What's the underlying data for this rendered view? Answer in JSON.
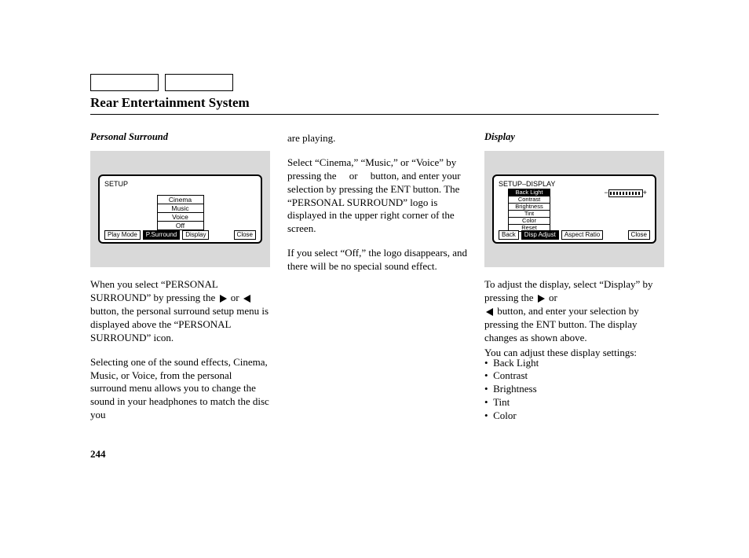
{
  "page_title": "Rear Entertainment System",
  "page_number": "244",
  "col1": {
    "heading": "Personal Surround",
    "screen": {
      "title": "SETUP",
      "menu": [
        "Cinema",
        "Music",
        "Voice",
        "Off"
      ],
      "tabs": {
        "play": "Play Mode",
        "selected": "P.Surround",
        "display": "Display",
        "close": "Close"
      }
    },
    "p1_a": "When you select “PERSONAL SURROUND” by pressing the",
    "p1_b": "or",
    "p1_c": "button, the personal surround setup menu is displayed above the “PERSONAL SURROUND” icon.",
    "p2": "Selecting one of the sound effects, Cinema, Music, or Voice, from the personal surround menu allows you to change the sound in your headphones to match the disc you"
  },
  "col2": {
    "p1": "are playing.",
    "p2": "Select “Cinema,” “Music,” or “Voice” by pressing the     or     button, and enter your selection by pressing the ENT button. The “PERSONAL SURROUND” logo is displayed in the upper right corner of the screen.",
    "p3": "If you select “Off,” the logo disappears, and there will be no special sound effect."
  },
  "col3": {
    "heading": "Display",
    "screen": {
      "title": "SETUP–DISPLAY",
      "list": [
        "Back Light",
        "Contrast",
        "Brightness",
        "Tint",
        "Color",
        "Reset"
      ],
      "tabs": {
        "back": "Back",
        "selected": "Disp Adjust",
        "aspect": "Aspect Ratio",
        "close": "Close"
      },
      "slider": {
        "minus": "−",
        "plus": "+"
      }
    },
    "p1_a": "To adjust the display, select “Display” by pressing the",
    "p1_b": "or",
    "p1_c": "button, and enter your selection by pressing the ENT button. The display changes as shown above.",
    "p2": "You can adjust these display settings:",
    "settings": [
      "Back Light",
      "Contrast",
      "Brightness",
      "Tint",
      "Color"
    ]
  }
}
